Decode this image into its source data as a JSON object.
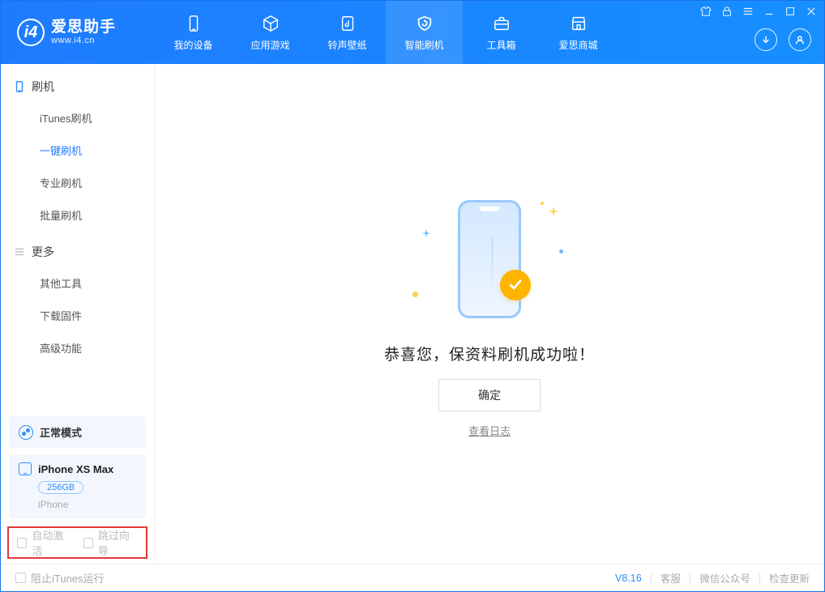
{
  "brand": {
    "title": "爱思助手",
    "subtitle": "www.i4.cn",
    "logo_letter": "i4"
  },
  "topnav": [
    {
      "id": "device",
      "label": "我的设备"
    },
    {
      "id": "apps",
      "label": "应用游戏"
    },
    {
      "id": "ring",
      "label": "铃声壁纸"
    },
    {
      "id": "flash",
      "label": "智能刷机"
    },
    {
      "id": "tools",
      "label": "工具箱"
    },
    {
      "id": "store",
      "label": "爱思商城"
    }
  ],
  "topnav_active": 3,
  "sidebar": {
    "groups": [
      {
        "title": "刷机",
        "items": [
          "iTunes刷机",
          "一键刷机",
          "专业刷机",
          "批量刷机"
        ],
        "active_index": 1
      },
      {
        "title": "更多",
        "items": [
          "其他工具",
          "下载固件",
          "高级功能"
        ],
        "active_index": -1
      }
    ],
    "mode_card": {
      "label": "正常模式"
    },
    "device_card": {
      "name": "iPhone XS Max",
      "storage": "256GB",
      "type": "iPhone"
    },
    "red_box": {
      "auto_activate": "自动激活",
      "skip_guide": "跳过向导"
    }
  },
  "main": {
    "success_msg": "恭喜您，保资料刷机成功啦！",
    "ok_btn": "确定",
    "view_log": "查看日志"
  },
  "statusbar": {
    "block_itunes": "阻止iTunes运行",
    "version": "V8.16",
    "svc": "客服",
    "wechat": "微信公众号",
    "update": "检查更新"
  }
}
